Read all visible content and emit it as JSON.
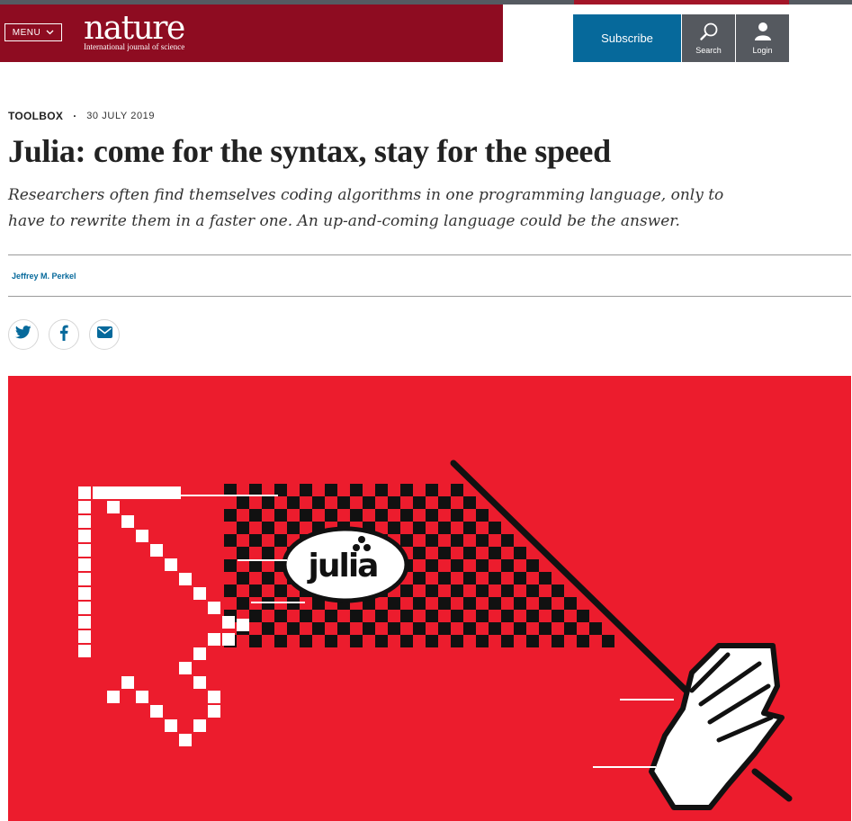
{
  "header": {
    "menu_label": "MENU",
    "logo_word": "nature",
    "logo_tagline": "International journal of science",
    "subscribe_label": "Subscribe",
    "search_label": "Search",
    "login_label": "Login",
    "colors": {
      "brand": "#8e0c21",
      "subscribe": "#06699b",
      "icon_buttons": "#55595f"
    }
  },
  "article": {
    "type": "TOOLBOX",
    "separator": "·",
    "date": "30 JULY 2019",
    "title": "Julia: come for the syntax, stay for the speed",
    "standfirst": "Researchers often find themselves coding algorithms in one programming language, only to have to rewrite them in a faster one. An up-and-coming language could be the answer.",
    "author": "Jeffrey M. Perkel"
  },
  "share": {
    "icons": [
      "twitter-icon",
      "facebook-icon",
      "email-icon"
    ]
  },
  "hero": {
    "logo_text": "julia",
    "background": "#ec1c2d"
  }
}
